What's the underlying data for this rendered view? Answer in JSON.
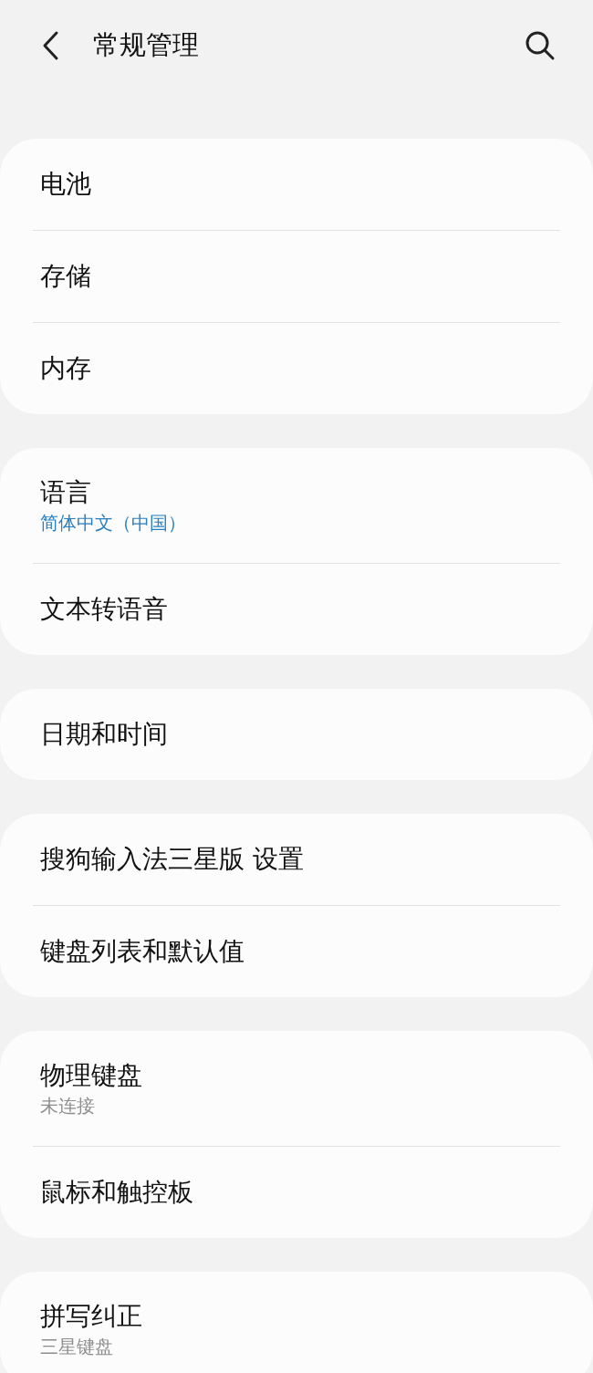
{
  "header": {
    "title": "常规管理"
  },
  "groups": [
    {
      "items": [
        {
          "label": "电池"
        },
        {
          "label": "存储"
        },
        {
          "label": "内存"
        }
      ]
    },
    {
      "items": [
        {
          "label": "语言",
          "subtitle": "简体中文（中国）",
          "kind": "accent"
        },
        {
          "label": "文本转语音"
        }
      ]
    },
    {
      "items": [
        {
          "label": "日期和时间"
        }
      ]
    },
    {
      "items": [
        {
          "label": "搜狗输入法三星版 设置"
        },
        {
          "label": "键盘列表和默认值"
        }
      ]
    },
    {
      "items": [
        {
          "label": "物理键盘",
          "subtitle": "未连接",
          "kind": "muted"
        },
        {
          "label": "鼠标和触控板"
        }
      ]
    },
    {
      "items": [
        {
          "label": "拼写纠正",
          "subtitle": "三星键盘",
          "kind": "muted"
        }
      ]
    }
  ]
}
